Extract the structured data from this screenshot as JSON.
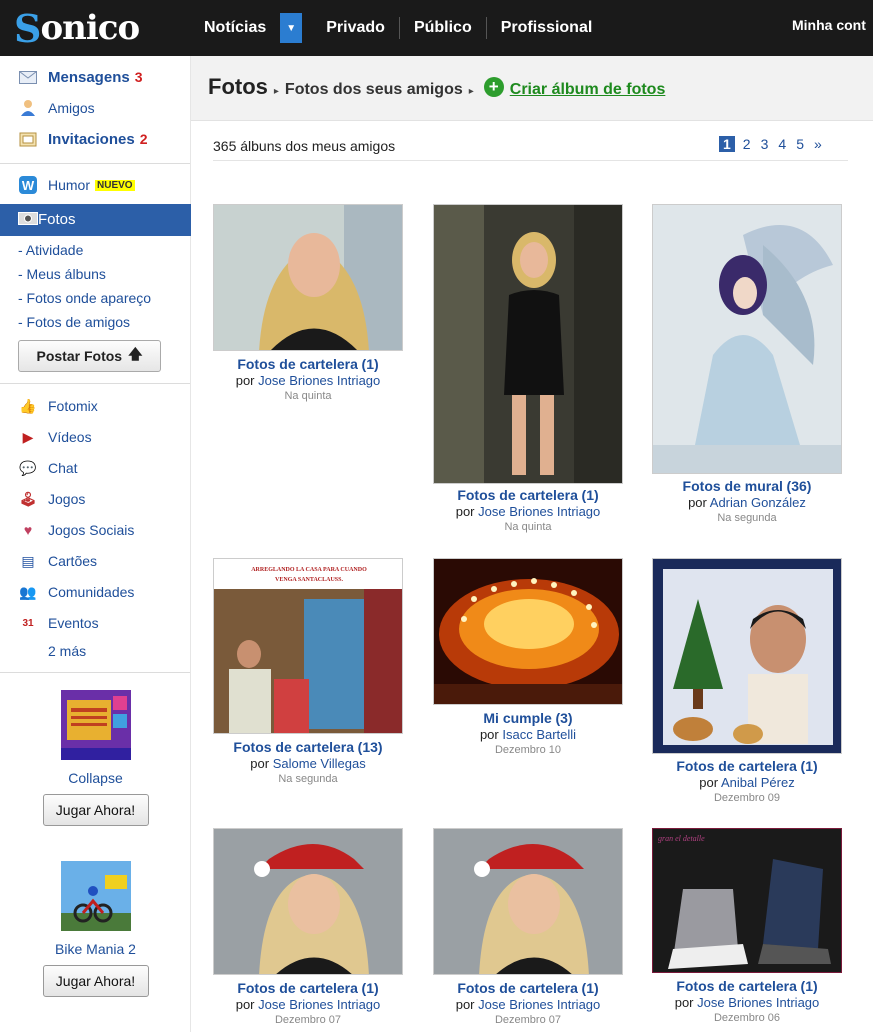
{
  "brand": {
    "logo_s": "S",
    "logo_rest": "onico"
  },
  "topnav": {
    "noticias": "Notícias",
    "dropdown_icon": "▼",
    "privado": "Privado",
    "publico": "Público",
    "profissional": "Profissional",
    "minha_conta": "Minha cont"
  },
  "sidebar": {
    "mensagens": {
      "label": "Mensagens",
      "count": "3",
      "icon": "envelope-icon"
    },
    "amigos": {
      "label": "Amigos",
      "icon": "person-icon"
    },
    "invitaciones": {
      "label": "Invitaciones",
      "count": "2",
      "icon": "invitation-icon"
    },
    "humor": {
      "label": "Humor",
      "badge": "NUEVO",
      "icon": "humor-icon"
    },
    "fotos": {
      "label": "Fotos",
      "icon": "camera-icon"
    },
    "sub_items": [
      "- Atividade",
      "- Meus álbuns",
      "- Fotos onde apareço",
      "- Fotos de amigos"
    ],
    "postar_fotos": "Postar Fotos",
    "postar_icon": "🡅",
    "apps": [
      {
        "label": "Fotomix",
        "icon": "hand-icon",
        "glyph": "👍"
      },
      {
        "label": "Vídeos",
        "icon": "youtube-icon",
        "glyph": "▶"
      },
      {
        "label": "Chat",
        "icon": "chat-icon",
        "glyph": "💬"
      },
      {
        "label": "Jogos",
        "icon": "joystick-icon",
        "glyph": "🕹"
      },
      {
        "label": "Jogos Sociais",
        "icon": "social-games-icon",
        "glyph": "♥"
      },
      {
        "label": "Cartões",
        "icon": "card-icon",
        "glyph": "▤"
      },
      {
        "label": "Comunidades",
        "icon": "community-icon",
        "glyph": "👥"
      },
      {
        "label": "Eventos",
        "icon": "calendar-icon",
        "glyph": "31"
      }
    ],
    "more": "2 más",
    "games": [
      {
        "name": "Collapse",
        "play": "Jugar Ahora!"
      },
      {
        "name": "Bike Mania 2",
        "play": "Jugar Ahora!"
      }
    ]
  },
  "header": {
    "title": "Fotos",
    "sep": "▸",
    "subtitle": "Fotos dos seus amigos",
    "create_icon": "+",
    "create_label": "Criar álbum de fotos"
  },
  "listing": {
    "count_text": "365 álbuns dos meus amigos",
    "pages": [
      "1",
      "2",
      "3",
      "4",
      "5",
      "»"
    ]
  },
  "albums": [
    {
      "title": "Fotos de cartelera",
      "count": "(1)",
      "by": "por",
      "author": "Jose Briones Intriago",
      "date": "Na quinta"
    },
    {
      "title": "Fotos de cartelera",
      "count": "(1)",
      "by": "por",
      "author": "Jose Briones Intriago",
      "date": "Na quinta"
    },
    {
      "title": "Fotos de mural",
      "count": "(36)",
      "by": "por",
      "author": "Adrian González",
      "date": "Na segunda"
    },
    {
      "title": "Fotos de cartelera",
      "count": "(13)",
      "by": "por",
      "author": "Salome Villegas",
      "date": "Na segunda"
    },
    {
      "title": "Mi cumple",
      "count": "(3)",
      "by": "por",
      "author": "Isacc Bartelli",
      "date": "Dezembro 10"
    },
    {
      "title": "Fotos de cartelera",
      "count": "(1)",
      "by": "por",
      "author": "Anibal Pérez",
      "date": "Dezembro 09"
    },
    {
      "title": "Fotos de cartelera",
      "count": "(1)",
      "by": "por",
      "author": "Jose Briones Intriago",
      "date": "Dezembro 07"
    },
    {
      "title": "Fotos de cartelera",
      "count": "(1)",
      "by": "por",
      "author": "Jose Briones Intriago",
      "date": "Dezembro 07"
    },
    {
      "title": "Fotos de cartelera",
      "count": "(1)",
      "by": "por",
      "author": "Jose Briones Intriago",
      "date": "Dezembro 06"
    }
  ],
  "photo_banners": {
    "album4_banner": "ARREGLANDO LA CASA PARA CUANDO VENGA SANTACLAUSS.",
    "album9_caption": "gran el detalle"
  }
}
